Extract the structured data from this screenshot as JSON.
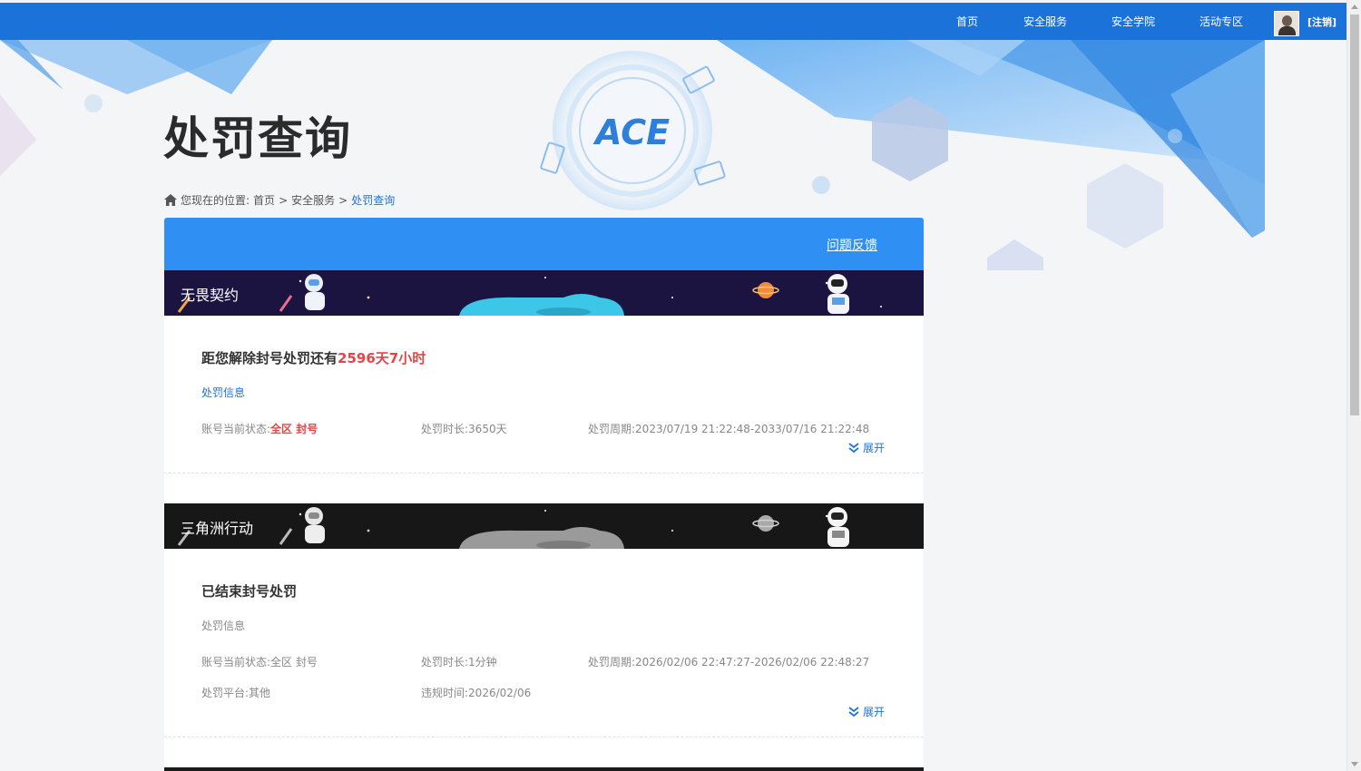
{
  "nav": {
    "items": [
      "首页",
      "安全服务",
      "安全学院",
      "活动专区"
    ],
    "logout": "[注销]"
  },
  "page": {
    "title": "处罚查询"
  },
  "breadcrumb": {
    "prefix": "您现在的位置:",
    "items": [
      "首页",
      "安全服务",
      "处罚查询"
    ],
    "separator": ">"
  },
  "panel": {
    "feedback": "问题反馈"
  },
  "cards": [
    {
      "game": "无畏契约",
      "status_prefix": "距您解除封号处罚还有",
      "status_highlight": "2596天7小时",
      "section_label": "处罚信息",
      "account_status_label": "账号当前状态:",
      "account_status_value": "全区 封号",
      "duration_label": "处罚时长:",
      "duration_value": "3650天",
      "period_label": "处罚周期:",
      "period_value": "2023/07/19 21:22:48-2033/07/16 21:22:48",
      "expand": "展开"
    },
    {
      "game": "三角洲行动",
      "status_prefix": "已结束封号处罚",
      "section_label": "处罚信息",
      "account_status_label": "账号当前状态:",
      "account_status_value": "全区 封号",
      "duration_label": "处罚时长:",
      "duration_value": "1分钟",
      "period_label": "处罚周期:",
      "period_value": "2026/02/06 22:47:27-2026/02/06 22:48:27",
      "platform_label": "处罚平台:",
      "platform_value": "其他",
      "violation_time_label": "违规时间:",
      "violation_time_value": "2026/02/06",
      "expand": "展开"
    }
  ],
  "colors": {
    "nav_blue": "#1b73d9",
    "panel_header": "#2f8ff2",
    "highlight_red": "#e64545",
    "active_banner_bg": "#1c1440",
    "ended_banner_bg": "#1a1a1a"
  },
  "icons": [
    "home-icon",
    "avatar",
    "ace-logo",
    "chevron-double-down-icon",
    "astronaut-icon",
    "planet-icon"
  ]
}
